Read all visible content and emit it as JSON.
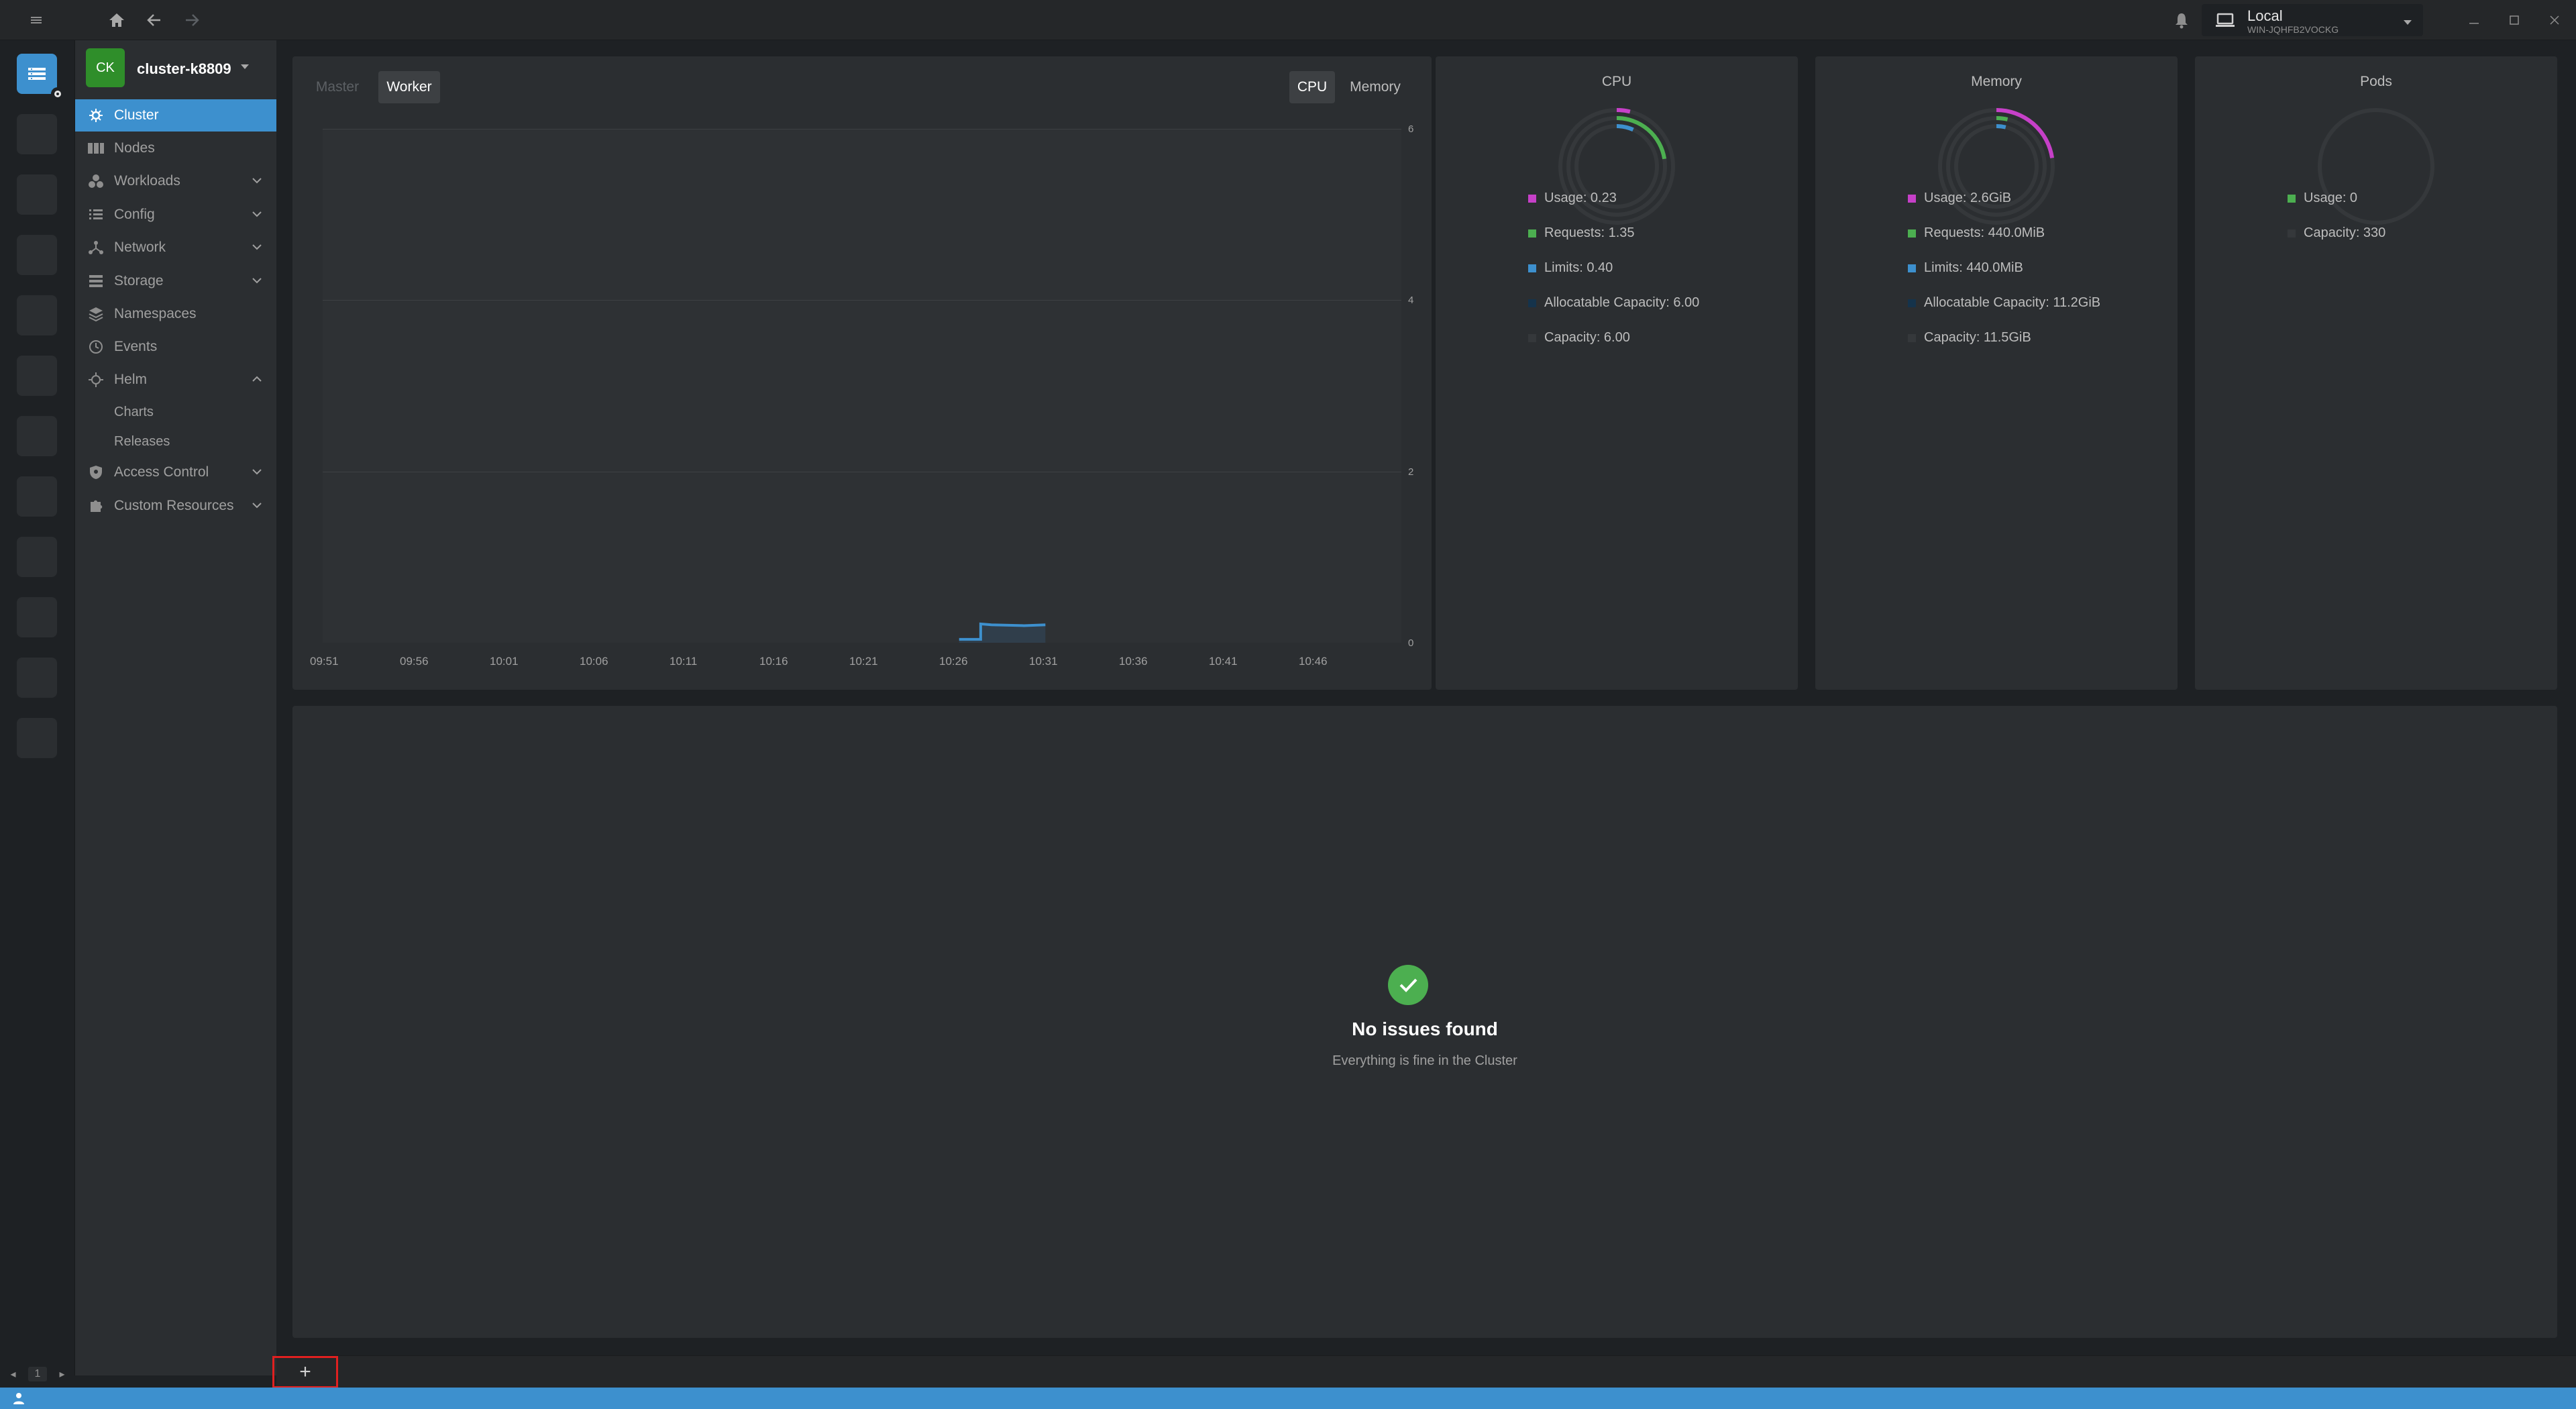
{
  "topbar": {
    "context": {
      "title": "Local",
      "subtitle": "WIN-JQHFB2VOCKG"
    },
    "icons": [
      "menu-icon",
      "home-icon",
      "back-arrow-icon",
      "forward-arrow-icon",
      "bell-icon",
      "laptop-icon",
      "chevron-down-icon",
      "minimize-icon",
      "maximize-icon",
      "close-icon"
    ]
  },
  "hotbar": {
    "page": "1"
  },
  "cluster": {
    "avatar": "CK",
    "name": "cluster-k8809"
  },
  "sidebar": {
    "items": [
      {
        "label": "Cluster",
        "icon": "cluster-icon",
        "active": true
      },
      {
        "label": "Nodes",
        "icon": "nodes-icon"
      },
      {
        "label": "Workloads",
        "icon": "workloads-icon",
        "expandable": true
      },
      {
        "label": "Config",
        "icon": "config-icon",
        "expandable": true
      },
      {
        "label": "Network",
        "icon": "network-icon",
        "expandable": true
      },
      {
        "label": "Storage",
        "icon": "storage-icon",
        "expandable": true
      },
      {
        "label": "Namespaces",
        "icon": "namespaces-icon"
      },
      {
        "label": "Events",
        "icon": "events-icon"
      },
      {
        "label": "Helm",
        "icon": "helm-icon",
        "expanded": true
      },
      {
        "label": "Access Control",
        "icon": "shield-icon",
        "expandable": true
      },
      {
        "label": "Custom Resources",
        "icon": "puzzle-icon",
        "expandable": true
      }
    ],
    "helm_children": [
      "Charts",
      "Releases"
    ]
  },
  "metrics": {
    "node_tabs": [
      "Master",
      "Worker"
    ],
    "metric_tabs": [
      "CPU",
      "Memory"
    ],
    "active_node_tab": "Worker",
    "active_metric_tab": "CPU"
  },
  "chart_data": {
    "type": "area",
    "x": [
      "09:51",
      "09:56",
      "10:01",
      "10:06",
      "10:11",
      "10:16",
      "10:21",
      "10:26",
      "10:31",
      "10:36",
      "10:41",
      "10:46"
    ],
    "y_ticks": [
      "6",
      "4",
      "2",
      "0"
    ],
    "ylim": [
      0,
      6
    ],
    "grid": true,
    "series": [
      {
        "color": "#3d90ce",
        "points": [
          [
            10.44,
            0.04
          ],
          [
            10.46,
            0.04
          ],
          [
            10.46,
            0.22
          ],
          [
            10.47,
            0.21
          ],
          [
            10.5,
            0.2
          ],
          [
            10.52,
            0.21
          ]
        ]
      }
    ]
  },
  "rings": {
    "cpu": {
      "title": "CPU",
      "legend": [
        {
          "label": "Usage: 0.23",
          "color": "#c640c8"
        },
        {
          "label": "Requests: 1.35",
          "color": "#4caf50"
        },
        {
          "label": "Limits: 0.40",
          "color": "#3d90ce"
        },
        {
          "label": "Allocatable Capacity: 6.00",
          "color": "#15334b"
        },
        {
          "label": "Capacity: 6.00",
          "color": "#2f3235"
        }
      ],
      "usage_fraction": 0.038,
      "requests_fraction": 0.225,
      "limits_fraction": 0.067
    },
    "memory": {
      "title": "Memory",
      "legend": [
        {
          "label": "Usage: 2.6GiB",
          "color": "#c640c8"
        },
        {
          "label": "Requests: 440.0MiB",
          "color": "#4caf50"
        },
        {
          "label": "Limits: 440.0MiB",
          "color": "#3d90ce"
        },
        {
          "label": "Allocatable Capacity: 11.2GiB",
          "color": "#15334b"
        },
        {
          "label": "Capacity: 11.5GiB",
          "color": "#2f3235"
        }
      ],
      "usage_fraction": 0.226,
      "requests_fraction": 0.037,
      "limits_fraction": 0.037
    },
    "pods": {
      "title": "Pods",
      "legend": [
        {
          "label": "Usage: 0",
          "color": "#4caf50"
        },
        {
          "label": "Capacity: 330",
          "color": "#2f3235"
        }
      ]
    }
  },
  "issues": {
    "title": "No issues found",
    "subtitle": "Everything is fine in the Cluster"
  },
  "dock": {
    "add_label": "+"
  }
}
